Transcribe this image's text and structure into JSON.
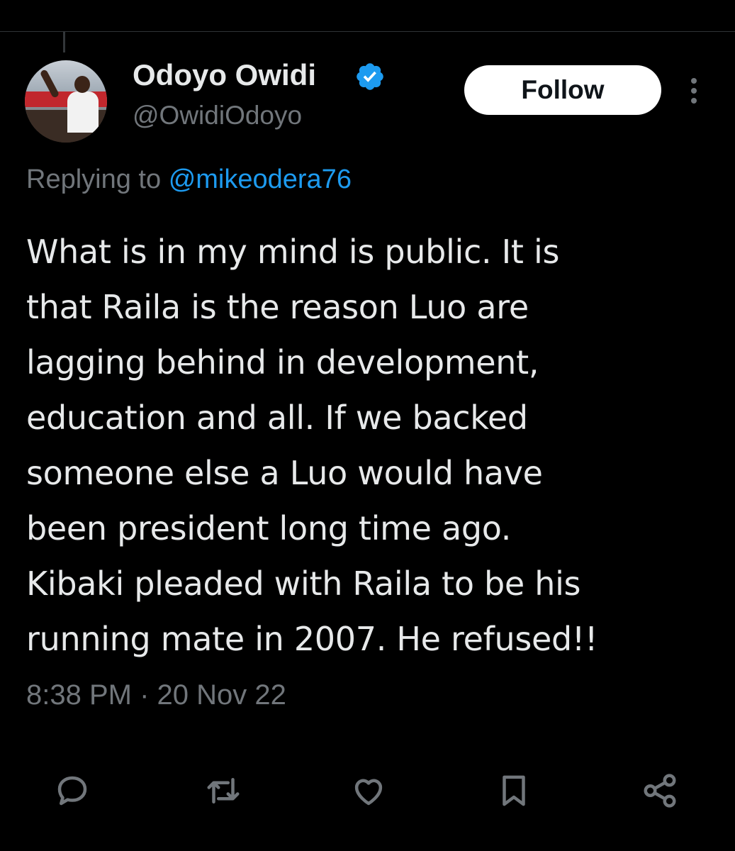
{
  "tweet": {
    "author": {
      "display_name": "Odoyo Owidi",
      "handle": "@OwidiOdoyo",
      "verified": true
    },
    "follow_label": "Follow",
    "replying_prefix": "Replying to",
    "replying_to": "@mikeodera76",
    "text_lines": [
      "What is in my mind is public. It is",
      "that Raila is the reason Luo are",
      "lagging behind in development,",
      "education and all. If we backed",
      "someone else a Luo would have",
      "been president long time ago.",
      "Kibaki pleaded with Raila to be his",
      "running mate in 2007. He refused!!"
    ],
    "timestamp": "8:38 PM · 20 Nov 22"
  },
  "actions": [
    {
      "icon": "reply-icon"
    },
    {
      "icon": "retweet-icon"
    },
    {
      "icon": "like-icon"
    },
    {
      "icon": "bookmark-icon"
    },
    {
      "icon": "share-icon"
    }
  ],
  "colors": {
    "background": "#000000",
    "text": "#e7e9ea",
    "secondary": "#71767b",
    "accent": "#1d9bf0"
  }
}
